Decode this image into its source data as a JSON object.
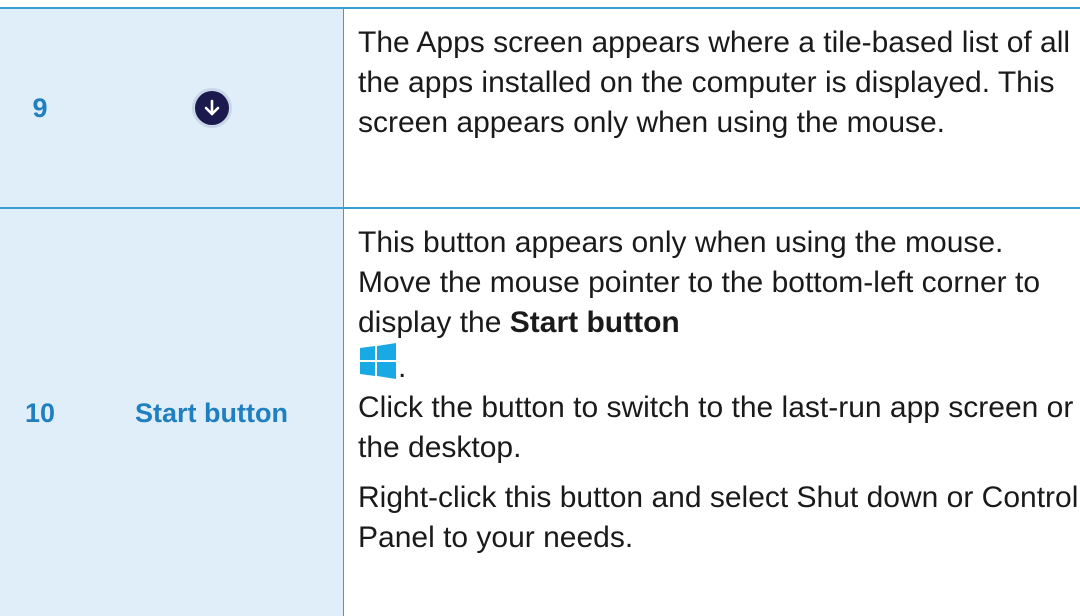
{
  "rows": [
    {
      "number": "9",
      "name": "",
      "icon": "apps-down-arrow-icon",
      "description": [
        "The Apps screen appears where a tile-based list of all the apps installed on the computer is displayed. This screen appears only when using the mouse."
      ]
    },
    {
      "number": "10",
      "name": "Start button",
      "icon": "windows-logo-icon",
      "description_p1_before": "This button appears only when using the mouse. Move the mouse pointer to the bottom-left corner to display the ",
      "description_p1_bold": "Start button",
      "description_p1_after": ".",
      "description_p1_continued": "Click the button to switch to the last-run app screen or the desktop.",
      "description_p2": "Right-click this button and select Shut down or Control Panel to your needs."
    }
  ],
  "colors": {
    "accent": "#3a9fd4",
    "label_text": "#1f7fbf",
    "cell_background": "#dfeef9",
    "windows_logo": "#19a9e5",
    "down_icon": "#1a1a4e"
  }
}
